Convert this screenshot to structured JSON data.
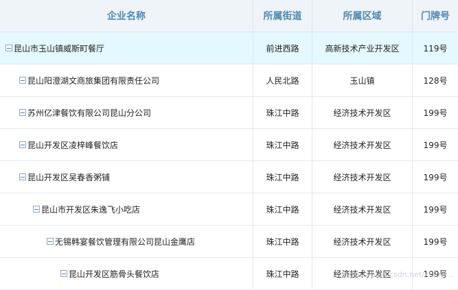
{
  "header": {
    "col_name": "企业名称",
    "col_street": "所属街道",
    "col_area": "所属区域",
    "col_number": "门牌号"
  },
  "rows": [
    {
      "name": "昆山市玉山镇威斯町餐厅",
      "street": "前进西路",
      "area": "高新技术产业开发区",
      "number": "119号"
    },
    {
      "name": "昆山阳澄湖文商旅集团有限责任公司",
      "street": "人民北路",
      "area": "玉山镇",
      "number": "128号"
    },
    {
      "name": "苏州亿津餐饮有限公司昆山分公司",
      "street": "珠江中路",
      "area": "经济技术开发区",
      "number": "199号"
    },
    {
      "name": "昆山开发区凌梓峰餐饮店",
      "street": "珠江中路",
      "area": "经济技术开发区",
      "number": "199号"
    },
    {
      "name": "昆山开发区吴春香粥铺",
      "street": "珠江中路",
      "area": "经济技术开发区",
      "number": "199号"
    },
    {
      "name": "昆山市开发区朱逸飞小吃店",
      "street": "珠江中路",
      "area": "经济技术开发区",
      "number": "199号"
    },
    {
      "name": "无锡韩宴餐饮管理有限公司昆山金鹰店",
      "street": "珠江中路",
      "area": "经济技术开发区",
      "number": "199号"
    },
    {
      "name": "昆山开发区筋骨头餐饮店",
      "street": "珠江中路",
      "area": "经济技术开发区",
      "number": "199号"
    }
  ],
  "watermark": "https://blog.csdn.net/xiaoyi..."
}
